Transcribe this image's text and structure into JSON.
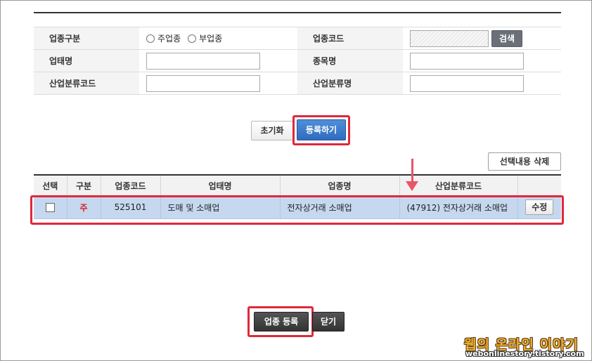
{
  "form": {
    "industry_type_label": "업종구분",
    "radio_main": "주업종",
    "radio_sub": "부업종",
    "industry_code_label": "업종코드",
    "industry_code_value": "",
    "search_button": "검색",
    "business_type_label": "업태명",
    "business_type_value": "",
    "item_name_label": "종목명",
    "item_name_value": "",
    "industrial_code_label": "산업분류코드",
    "industrial_code_value": "",
    "industrial_name_label": "산업분류명",
    "industrial_name_value": ""
  },
  "actions": {
    "reset": "초기화",
    "register": "등록하기",
    "delete_selected": "선택내용 삭제"
  },
  "table": {
    "headers": [
      "선택",
      "구분",
      "업종코드",
      "업태명",
      "업종명",
      "산업분류코드",
      ""
    ],
    "rows": [
      {
        "type": "주",
        "code": "525101",
        "business_type": "도매 및 소매업",
        "industry_name": "전자상거래 소매업",
        "industrial_code": "(47912) 전자상거래 소매업",
        "edit": "수정"
      }
    ]
  },
  "footer": {
    "industry_register": "업종 등록",
    "close": "닫기"
  },
  "watermark": {
    "title": "웹의 온라인 이야기",
    "url": "webonlinestory.tistory.com"
  },
  "colors": {
    "highlight": "#e0283a",
    "primary_button": "#2f6cbf",
    "selected_row": "#c6d8ef",
    "main_type": "#d62020"
  }
}
